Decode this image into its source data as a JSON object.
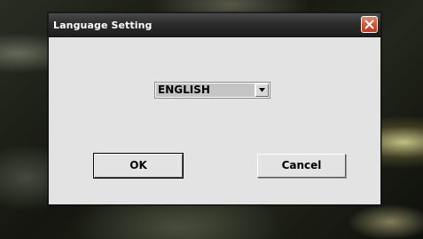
{
  "dialog": {
    "title": "Language Setting",
    "close_icon": "close-x-icon",
    "language_select": {
      "selected_value": "ENGLISH",
      "arrow_icon": "dropdown-arrow-icon"
    },
    "buttons": {
      "ok_label": "OK",
      "cancel_label": "Cancel"
    }
  },
  "colors": {
    "titlebar": "#2c2c2c",
    "title_text": "#ffffff",
    "close_button": "#d4502f",
    "dialog_background": "#e3e3e3",
    "select_highlight": "#c4c4c4"
  }
}
